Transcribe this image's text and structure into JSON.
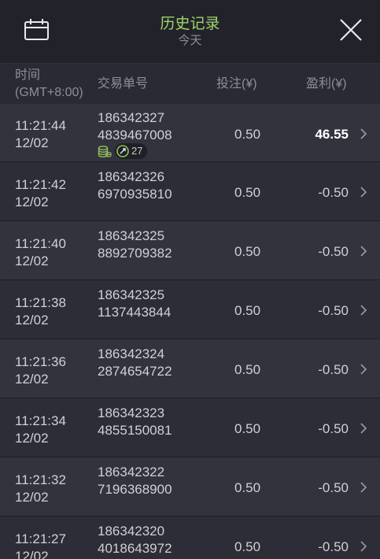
{
  "header": {
    "title": "历史记录",
    "subtitle": "今天",
    "calendar_icon": "calendar-icon",
    "close_icon": "close-icon"
  },
  "columns": {
    "time_line1": "时间",
    "time_line2": "(GMT+8:00)",
    "id": "交易单号",
    "bet": "投注(¥)",
    "profit": "盈利(¥)"
  },
  "rows": [
    {
      "time": "11:21:44",
      "date": "12/02",
      "id1": "186342327",
      "id2": "4839467008",
      "bet": "0.50",
      "profit": "46.55",
      "win": true,
      "badge_count": "27"
    },
    {
      "time": "11:21:42",
      "date": "12/02",
      "id1": "186342326",
      "id2": "6970935810",
      "bet": "0.50",
      "profit": "-0.50"
    },
    {
      "time": "11:21:40",
      "date": "12/02",
      "id1": "186342325",
      "id2": "8892709382",
      "bet": "0.50",
      "profit": "-0.50"
    },
    {
      "time": "11:21:38",
      "date": "12/02",
      "id1": "186342325",
      "id2": "1137443844",
      "bet": "0.50",
      "profit": "-0.50"
    },
    {
      "time": "11:21:36",
      "date": "12/02",
      "id1": "186342324",
      "id2": "2874654722",
      "bet": "0.50",
      "profit": "-0.50"
    },
    {
      "time": "11:21:34",
      "date": "12/02",
      "id1": "186342323",
      "id2": "4855150081",
      "bet": "0.50",
      "profit": "-0.50"
    },
    {
      "time": "11:21:32",
      "date": "12/02",
      "id1": "186342322",
      "id2": "7196368900",
      "bet": "0.50",
      "profit": "-0.50"
    },
    {
      "time": "11:21:27",
      "date": "12/02",
      "id1": "186342320",
      "id2": "4018643972",
      "bet": "0.50",
      "profit": "-0.50"
    }
  ],
  "colors": {
    "accent_title": "#9ed46a",
    "background": "#22232a",
    "row_odd": "#32333d",
    "row_even": "#2c2d36",
    "coin_green": "#8fbf5a"
  }
}
